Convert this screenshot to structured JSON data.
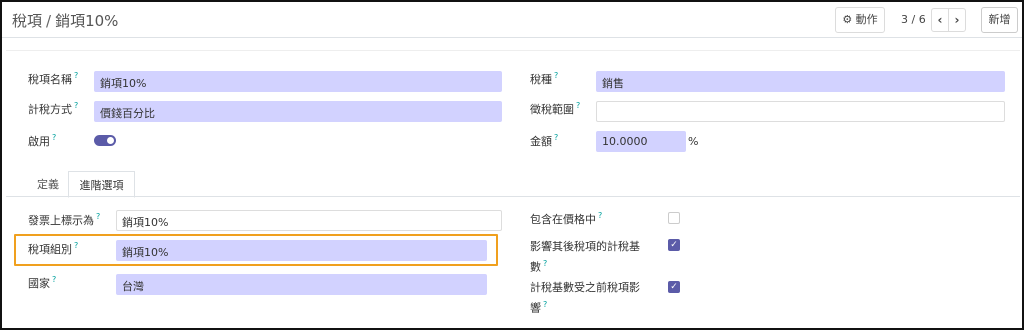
{
  "breadcrumb": {
    "parent": "稅項",
    "separator": "/",
    "current": "銷項10%"
  },
  "toolbar": {
    "action_label": "⚙ 動作",
    "pager_text": "3 / 6",
    "prev": "‹",
    "next": "›",
    "new_label": "新增"
  },
  "form": {
    "tax_name": {
      "label": "稅項名稱",
      "value": "銷項10%"
    },
    "tax_type": {
      "label": "稅種",
      "value": "銷售"
    },
    "computation": {
      "label": "計稅方式",
      "value": "價錢百分比"
    },
    "tax_scope": {
      "label": "徵稅範圍",
      "value": ""
    },
    "active": {
      "label": "啟用",
      "value": true
    },
    "amount": {
      "label": "金額",
      "value": "10.0000",
      "unit": "%"
    }
  },
  "tabs": [
    {
      "label": "定義",
      "active": false
    },
    {
      "label": "進階選項",
      "active": true
    }
  ],
  "advanced": {
    "invoice_label": {
      "label": "發票上標示為",
      "value": "銷項10%"
    },
    "tax_group": {
      "label": "稅項組別",
      "value": "銷項10%"
    },
    "country": {
      "label": "國家",
      "value": "台灣"
    },
    "price_include": {
      "label": "包含在價格中",
      "checked": false
    },
    "affect_base_line1": "影響其後稅項的計稅基",
    "affect_base_line2": "數",
    "affect_base_checked": true,
    "base_affected_line1": "計稅基數受之前稅項影",
    "base_affected_line2": "響",
    "base_affected_checked": true
  },
  "help_mark": "?",
  "colors": {
    "required_bg": "#d2d2ff",
    "toggle_on": "#5b5ba8",
    "highlight": "#f0a01e",
    "help": "#00a09d"
  }
}
